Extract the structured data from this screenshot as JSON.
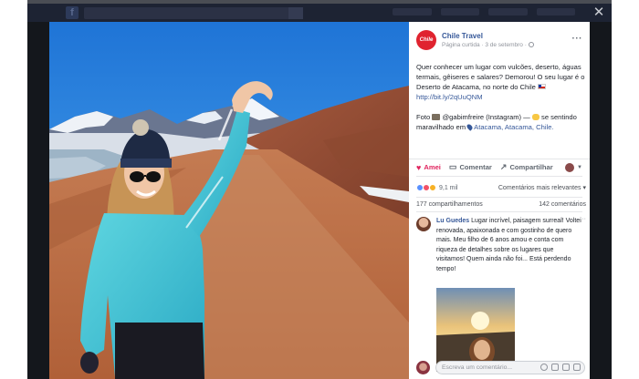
{
  "close_label": "✕",
  "post": {
    "page_name": "Chile Travel",
    "avatar_text": "Chile",
    "meta": "Página curtida · 3 de setembro ·",
    "text_line1": "Quer conhecer um lugar com vulcões, deserto, águas termais, gêiseres e salares? Demorou! O seu lugar é o Deserto de Atacama, no norte do Chile",
    "link": "http://bit.ly/2qUuQNM",
    "photo_credit_prefix": "Foto",
    "photo_credit_handle": "@gabimfreire (Instagram) —",
    "feeling_text": "se sentindo maravilhado em",
    "location": "Atacama, Atacama, Chile."
  },
  "actions": {
    "like": "Amei",
    "comment": "Comentar",
    "share": "Compartilhar"
  },
  "reactions": {
    "count": "9,1 mil",
    "filter": "Comentários mais relevantes"
  },
  "stats": {
    "shares": "177 compartilhamentos",
    "comments": "142 comentários"
  },
  "comment": {
    "author": "Lu Guedes",
    "text": "Lugar incrível, paisagem surreal! Voltei renovada, apaixonada e com gostinho de quero mais. Meu filho de 6 anos amou e conta com riqueza de detalhes sobre os lugares que visitamos! Quem ainda não foi... Está perdendo tempo!"
  },
  "composer": {
    "placeholder": "Escreva um comentário..."
  },
  "colors": {
    "link": "#365899",
    "love": "#e0245e",
    "brand": "#e0232f"
  }
}
